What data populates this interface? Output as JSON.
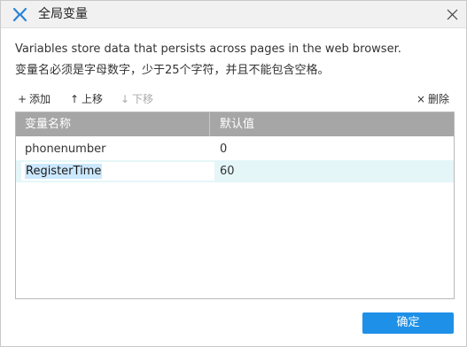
{
  "window": {
    "title": "全局变量"
  },
  "description": {
    "line1": "Variables store data that persists across pages in the web browser.",
    "line2": "变量名必须是字母数字，少于25个字符，并且不能包含空格。"
  },
  "toolbar": {
    "add_label": "添加",
    "up_label": "上移",
    "down_label": "下移",
    "delete_label": "删除"
  },
  "table": {
    "columns": [
      "变量名称",
      "默认值"
    ],
    "rows": [
      {
        "name": "phonenumber",
        "default": "0"
      },
      {
        "name": "RegisterTime",
        "default": "60"
      }
    ]
  },
  "footer": {
    "ok_label": "确定"
  },
  "colors": {
    "accent": "#1e90e8",
    "header_bg": "#a6a6a6",
    "selected_row": "#e5f6f9",
    "text_selection": "#cce8ff",
    "logo": "#2b84d6"
  },
  "icons": {
    "logo": "axure-logo-icon",
    "close": "close-icon",
    "add": "plus-icon",
    "up": "arrow-up-icon",
    "down": "arrow-down-icon",
    "delete": "x-icon"
  }
}
